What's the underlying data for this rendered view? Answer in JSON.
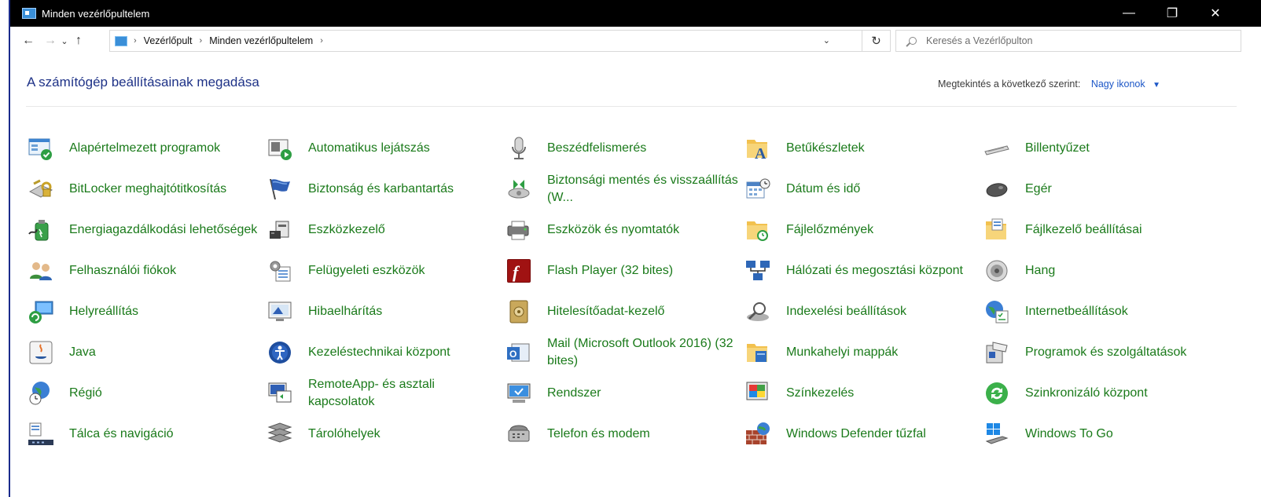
{
  "window": {
    "title": "Minden vezérlőpultelem"
  },
  "controls": {
    "minimize": "—",
    "maximize": "❐",
    "close": "✕"
  },
  "nav": {
    "back": "←",
    "forward": "→",
    "recent": "⌄",
    "up": "↑"
  },
  "address": {
    "crumbs": [
      "Vezérlőpult",
      "Minden vezérlőpultelem"
    ],
    "separator": "›",
    "dropdown": "⌄",
    "refresh": "↻"
  },
  "search": {
    "placeholder": "Keresés a Vezérlőpulton"
  },
  "header": {
    "title": "A számítógép beállításainak megadása",
    "view_by_label": "Megtekintés a következő szerint:",
    "view_by_value": "Nagy ikonok",
    "caret": "▼"
  },
  "items": [
    {
      "label": "Alapértelmezett programok",
      "icon": "default-programs-icon"
    },
    {
      "label": "Automatikus lejátszás",
      "icon": "autoplay-icon"
    },
    {
      "label": "Beszédfelismerés",
      "icon": "microphone-icon"
    },
    {
      "label": "Betűkészletek",
      "icon": "fonts-icon"
    },
    {
      "label": "Billentyűzet",
      "icon": "keyboard-icon"
    },
    {
      "label": "BitLocker meghajtótitkosítás",
      "icon": "bitlocker-icon"
    },
    {
      "label": "Biztonság és karbantartás",
      "icon": "flag-icon"
    },
    {
      "label": "Biztonsági mentés és visszaállítás (W...",
      "icon": "backup-icon"
    },
    {
      "label": "Dátum és idő",
      "icon": "calendar-clock-icon"
    },
    {
      "label": "Egér",
      "icon": "mouse-icon"
    },
    {
      "label": "Energiagazdálkodási lehetőségek",
      "icon": "power-options-icon"
    },
    {
      "label": "Eszközkezelő",
      "icon": "device-manager-icon"
    },
    {
      "label": "Eszközök és nyomtatók",
      "icon": "printer-icon"
    },
    {
      "label": "Fájlelőzmények",
      "icon": "file-history-icon"
    },
    {
      "label": "Fájlkezelő beállításai",
      "icon": "folder-options-icon"
    },
    {
      "label": "Felhasználói fiókok",
      "icon": "users-icon"
    },
    {
      "label": "Felügyeleti eszközök",
      "icon": "admin-tools-icon"
    },
    {
      "label": "Flash Player (32 bites)",
      "icon": "flash-icon"
    },
    {
      "label": "Hálózati és megosztási központ",
      "icon": "network-icon"
    },
    {
      "label": "Hang",
      "icon": "speaker-icon"
    },
    {
      "label": "Helyreállítás",
      "icon": "recovery-icon"
    },
    {
      "label": "Hibaelhárítás",
      "icon": "troubleshoot-icon"
    },
    {
      "label": "Hitelesítőadat-kezelő",
      "icon": "credential-vault-icon"
    },
    {
      "label": "Indexelési beállítások",
      "icon": "indexing-icon"
    },
    {
      "label": "Internetbeállítások",
      "icon": "internet-options-icon"
    },
    {
      "label": "Java",
      "icon": "java-icon"
    },
    {
      "label": "Kezeléstechnikai központ",
      "icon": "ease-of-access-icon"
    },
    {
      "label": "Mail (Microsoft Outlook 2016) (32 bites)",
      "icon": "mail-icon"
    },
    {
      "label": "Munkahelyi mappák",
      "icon": "work-folders-icon"
    },
    {
      "label": "Programok és szolgáltatások",
      "icon": "programs-icon"
    },
    {
      "label": "Régió",
      "icon": "region-icon"
    },
    {
      "label": "RemoteApp- és asztali kapcsolatok",
      "icon": "remoteapp-icon"
    },
    {
      "label": "Rendszer",
      "icon": "system-icon"
    },
    {
      "label": "Színkezelés",
      "icon": "color-management-icon"
    },
    {
      "label": "Szinkronizáló központ",
      "icon": "sync-center-icon"
    },
    {
      "label": "Tálca és navigáció",
      "icon": "taskbar-icon"
    },
    {
      "label": "Tárolóhelyek",
      "icon": "storage-spaces-icon"
    },
    {
      "label": "Telefon és modem",
      "icon": "phone-modem-icon"
    },
    {
      "label": "Windows Defender tűzfal",
      "icon": "firewall-icon"
    },
    {
      "label": "Windows To Go",
      "icon": "windows-to-go-icon"
    }
  ],
  "colors": {
    "link_green": "#1a7a1a",
    "title_blue": "#1e3287",
    "accent_blue": "#1d57c7"
  }
}
